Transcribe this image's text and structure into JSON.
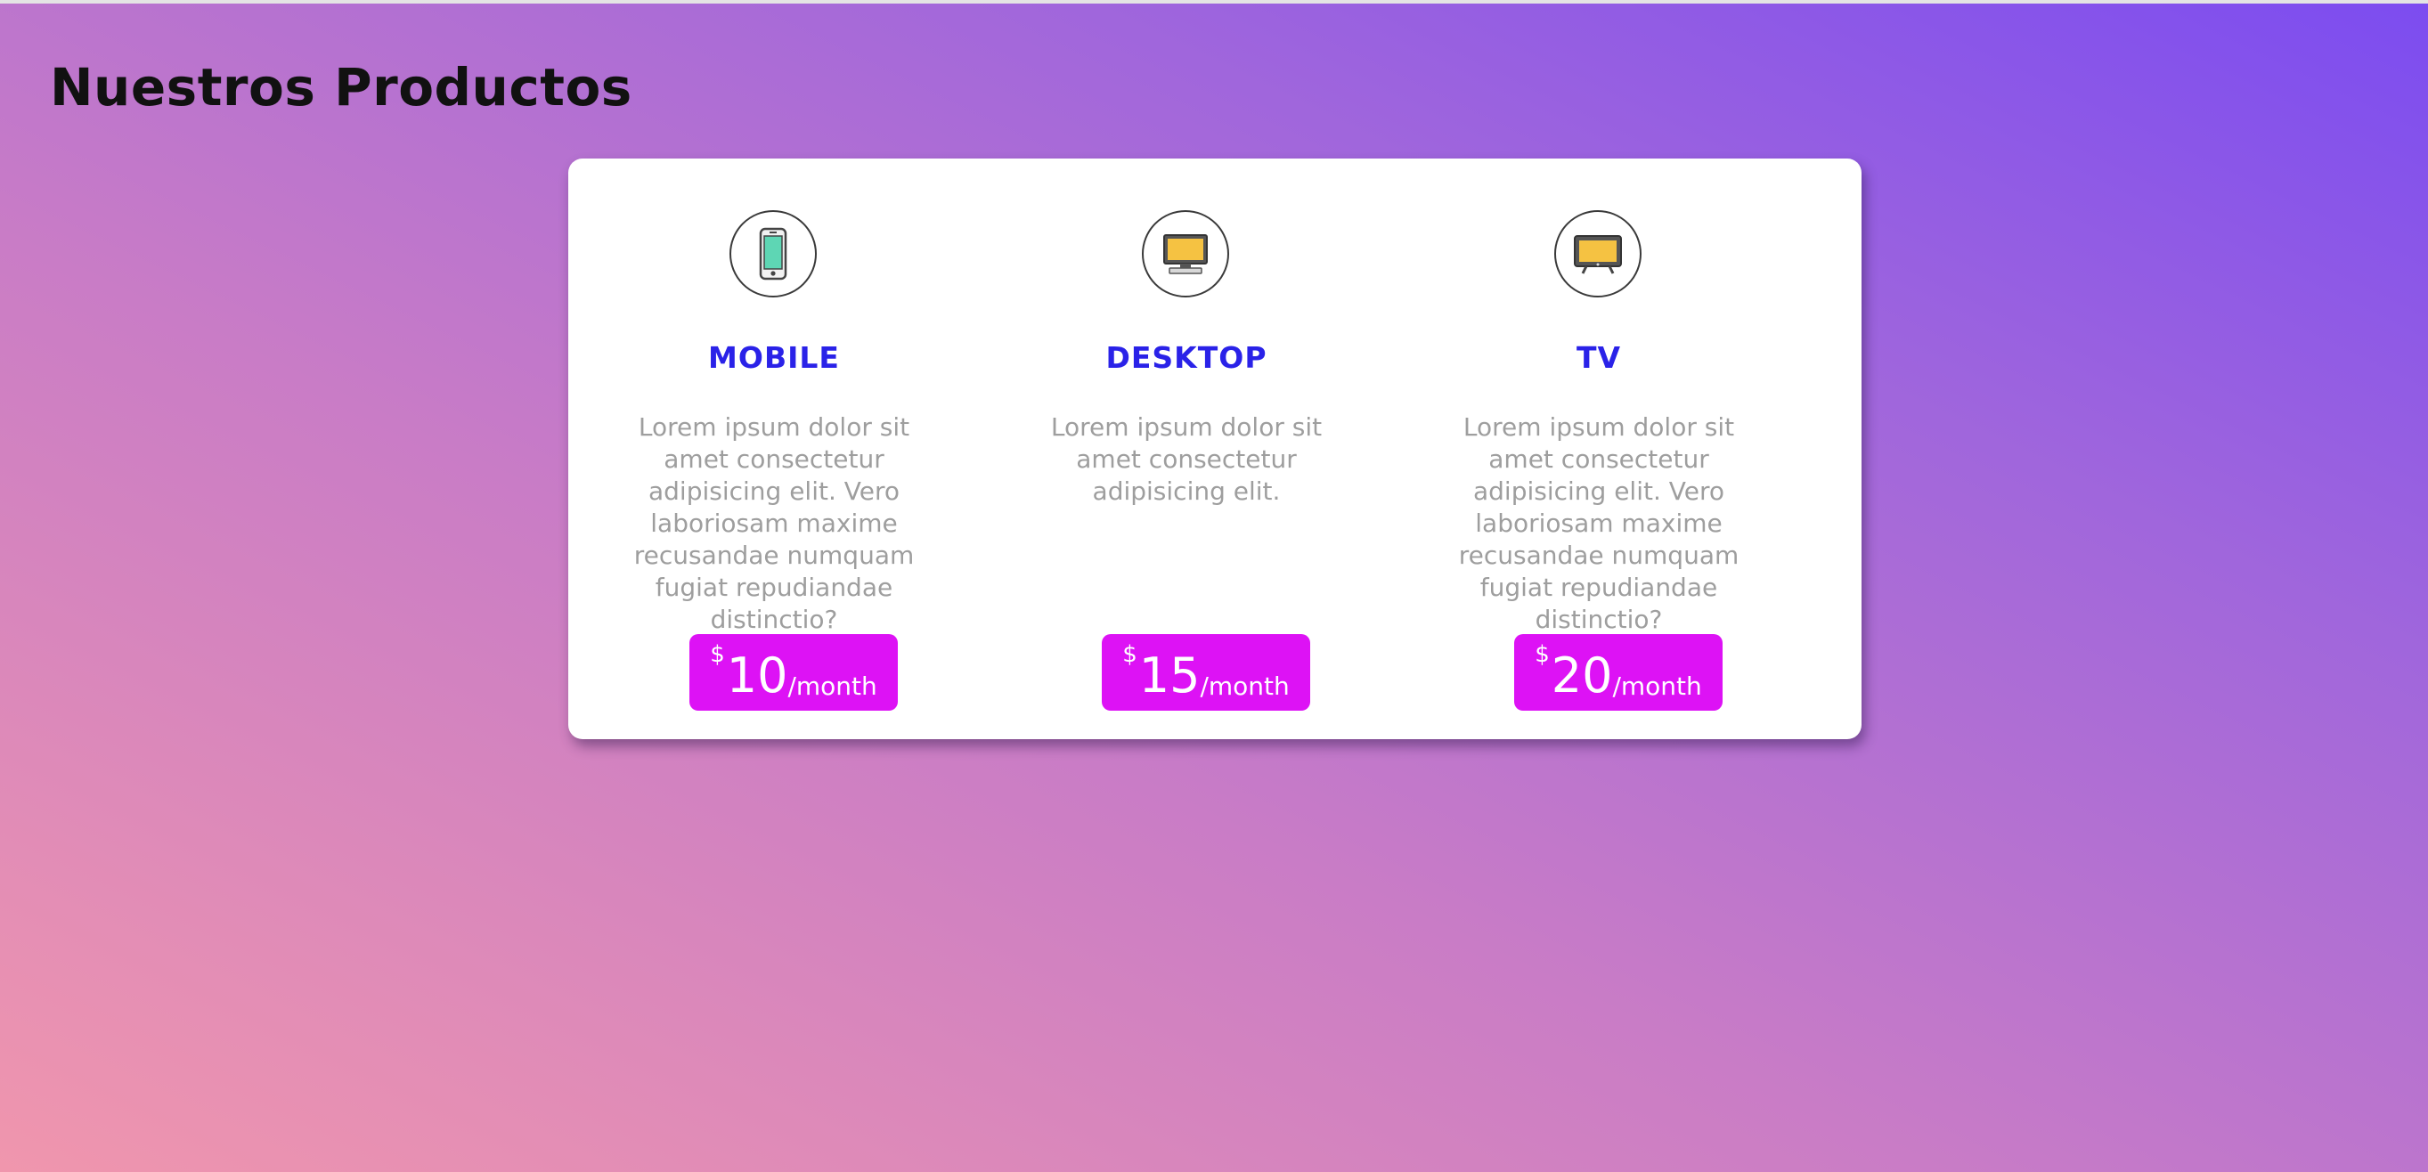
{
  "page": {
    "title": "Nuestros Productos"
  },
  "colors": {
    "accent_price": "#dd12f5",
    "product_name": "#2a22e8",
    "description": "#9e9e9e",
    "gradient_start": "#f096ad",
    "gradient_end": "#7c4cf0"
  },
  "products": [
    {
      "icon": "smartphone-icon",
      "name": "MOBILE",
      "description": "Lorem ipsum dolor sit amet consectetur adipisicing elit. Vero laboriosam maxime recusandae numquam fugiat repudiandae distinctio?",
      "currency": "$",
      "price": "10",
      "period": "/month"
    },
    {
      "icon": "desktop-monitor-icon",
      "name": "DESKTOP",
      "description": "Lorem ipsum dolor sit amet consectetur adipisicing elit.",
      "currency": "$",
      "price": "15",
      "period": "/month"
    },
    {
      "icon": "tv-icon",
      "name": "TV",
      "description": "Lorem ipsum dolor sit amet consectetur adipisicing elit. Vero laboriosam maxime recusandae numquam fugiat repudiandae distinctio?",
      "currency": "$",
      "price": "20",
      "period": "/month"
    }
  ]
}
